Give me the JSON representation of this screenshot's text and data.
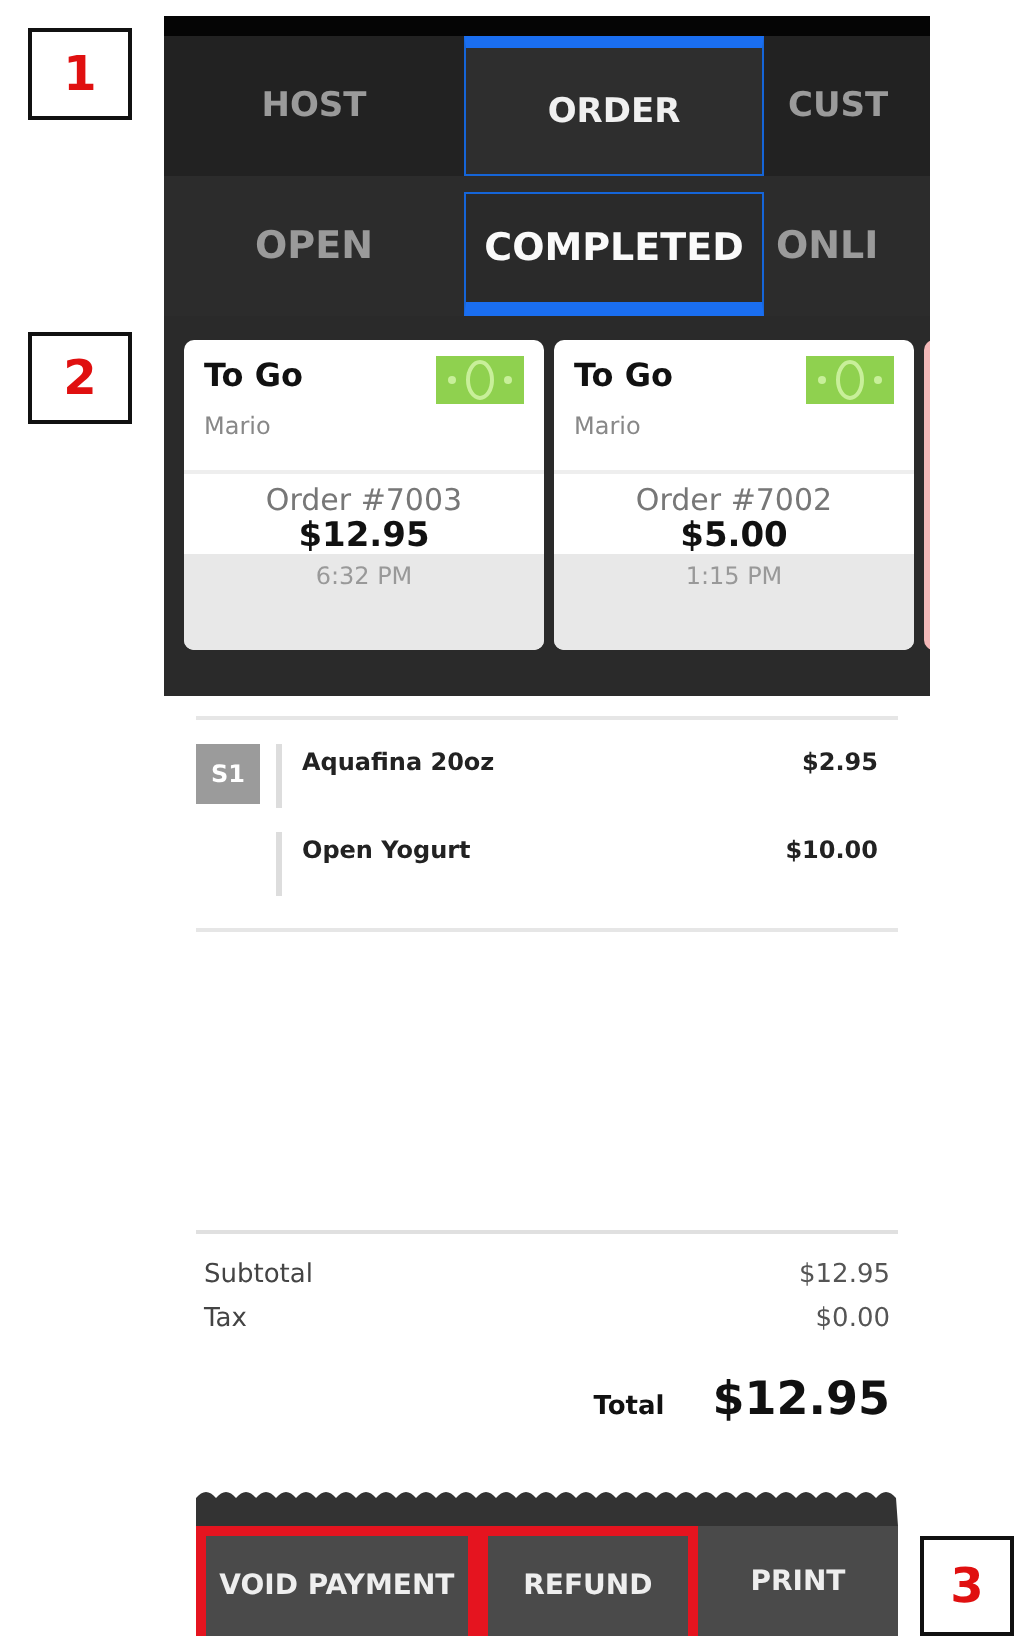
{
  "left_callouts": [
    {
      "label": "1"
    },
    {
      "label": "2"
    }
  ],
  "right_callouts": [
    {
      "label": "3"
    }
  ],
  "tabs": [
    {
      "label": "HOST",
      "selected": false
    },
    {
      "label": "ORDER",
      "selected": true
    },
    {
      "label": "CUST",
      "selected": false
    }
  ],
  "subtabs": [
    {
      "label": "OPEN",
      "selected": false
    },
    {
      "label": "COMPLETED",
      "selected": true
    },
    {
      "label": "ONLI",
      "selected": false
    }
  ],
  "orders": [
    {
      "kind": "card",
      "type": "To Go",
      "server": "Mario",
      "number": "Order #7003",
      "amount": "$12.95",
      "time": "6:32 PM"
    },
    {
      "kind": "card",
      "type": "To Go",
      "server": "Mario",
      "number": "Order #7002",
      "amount": "$5.00",
      "time": "1:15 PM"
    },
    {
      "kind": "stub"
    }
  ],
  "items": [
    {
      "seat": "S1",
      "name": "Aquafina 20oz",
      "price": "$2.95"
    },
    {
      "name": "Open Yogurt",
      "price": "$10.00"
    }
  ],
  "totals": {
    "subtotal_label": "Subtotal",
    "subtotal": "$12.95",
    "tax_label": "Tax",
    "tax": "$0.00",
    "total_label": "Total",
    "total": "$12.95"
  },
  "actions": [
    {
      "label": "VOID PAYMENT",
      "highlighted": true
    },
    {
      "label": "REFUND",
      "highlighted": true
    },
    {
      "label": "PRINT",
      "highlighted": false
    }
  ]
}
